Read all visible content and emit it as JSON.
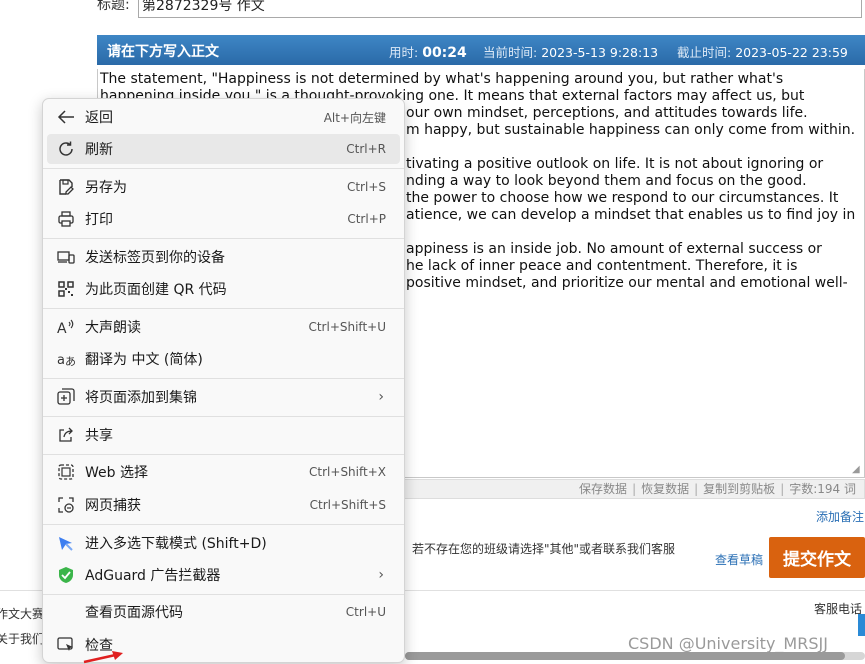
{
  "form": {
    "title_label": "标题:",
    "title_value": "第2872329号 作文"
  },
  "editor": {
    "prompt": "请在下方写入正文",
    "elapsed_label": "用时:",
    "elapsed_value": "00:24",
    "current_time_label": "当前时间:",
    "current_time_value": "2023-5-13 9:28:13",
    "deadline_label": "截止时间:",
    "deadline_value": "2023-05-22 23:59",
    "text_line1": "The statement, \"Happiness is not determined by what's happening around you, but rather what's",
    "text_line2": "happening inside you,\" is a thought-provoking one. It means that external factors may affect us, but",
    "text_line3": "our own mindset, perceptions, and attitudes towards life.",
    "text_line4": "m happy, but sustainable happiness can only come from within.",
    "text_line5": "tivating a positive outlook on life. It is not about ignoring or",
    "text_line6": "nding a way to look beyond them and focus on the good.",
    "text_line7": "the power to choose how we respond to our circumstances. It",
    "text_line8": "atience, we can develop a mindset that enables us to find joy in",
    "text_line9": "appiness is an inside job. No amount of external success or",
    "text_line10": "he lack of inner peace and contentment. Therefore, it is",
    "text_line11": "positive mindset, and prioritize our mental and emotional well-",
    "tools": {
      "save": "保存数据",
      "restore": "恢复数据",
      "copy": "复制到剪贴板",
      "word_count": "字数:194 词"
    }
  },
  "actions": {
    "add_note": "添加备注",
    "class_hint": "。若不存在您的班级请选择\"其他\"或者联系我们客服",
    "view_draft": "查看草稿",
    "submit": "提交作文"
  },
  "footer": {
    "left1": "作文大赛",
    "left2": "关于我们",
    "right": "客服电话"
  },
  "watermark": "CSDN @University_MRSJJ",
  "context_menu": {
    "items": [
      {
        "label": "返回",
        "shortcut": "Alt+向左键",
        "icon": "back-arrow-icon"
      },
      {
        "label": "刷新",
        "shortcut": "Ctrl+R",
        "icon": "refresh-icon"
      },
      {
        "label": "另存为",
        "shortcut": "Ctrl+S",
        "icon": "save-as-icon"
      },
      {
        "label": "打印",
        "shortcut": "Ctrl+P",
        "icon": "print-icon"
      },
      {
        "label": "发送标签页到你的设备",
        "shortcut": "",
        "icon": "send-to-device-icon"
      },
      {
        "label": "为此页面创建 QR 代码",
        "shortcut": "",
        "icon": "qr-code-icon"
      },
      {
        "label": "大声朗读",
        "shortcut": "Ctrl+Shift+U",
        "icon": "read-aloud-icon"
      },
      {
        "label": "翻译为 中文 (简体)",
        "shortcut": "",
        "icon": "translate-icon"
      },
      {
        "label": "将页面添加到集锦",
        "shortcut": "",
        "icon": "collections-icon"
      },
      {
        "label": "共享",
        "shortcut": "",
        "icon": "share-icon"
      },
      {
        "label": "Web 选择",
        "shortcut": "Ctrl+Shift+X",
        "icon": "web-select-icon"
      },
      {
        "label": "网页捕获",
        "shortcut": "Ctrl+Shift+S",
        "icon": "web-capture-icon"
      },
      {
        "label": "进入多选下载模式 (Shift+D)",
        "shortcut": "",
        "icon": "multi-download-icon"
      },
      {
        "label": "AdGuard 广告拦截器",
        "shortcut": "",
        "icon": "adguard-shield-icon"
      },
      {
        "label": "查看页面源代码",
        "shortcut": "Ctrl+U",
        "icon": ""
      },
      {
        "label": "检查",
        "shortcut": "",
        "icon": "inspect-icon"
      }
    ]
  },
  "colors": {
    "header_blue": "#2a6aa8",
    "submit_orange": "#d9620f",
    "link_blue": "#2a6fb5",
    "adguard_green": "#3bb54a",
    "download_blue": "#3d7ef0"
  }
}
